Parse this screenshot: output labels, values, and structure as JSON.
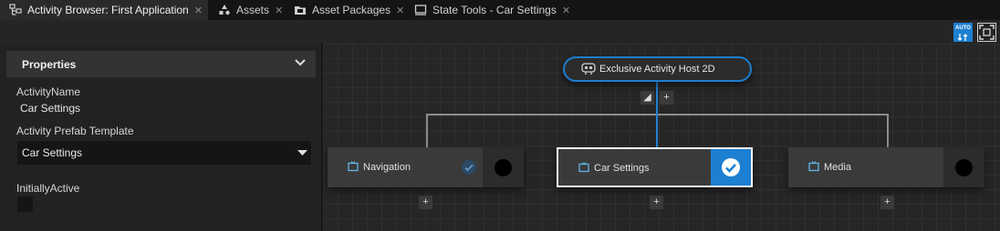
{
  "tabs": [
    {
      "label": "Activity Browser: First Application",
      "icon": "activity-tree-icon",
      "active": true
    },
    {
      "label": "Assets",
      "icon": "assets-icon",
      "active": false
    },
    {
      "label": "Asset Packages",
      "icon": "asset-packages-icon",
      "active": false
    },
    {
      "label": "State Tools - Car Settings",
      "icon": "state-tools-icon",
      "active": false
    }
  ],
  "toolbar": {
    "auto_label": "AUTO"
  },
  "properties": {
    "header": "Properties",
    "activity_name_label": "ActivityName",
    "activity_name_value": "Car Settings",
    "prefab_label": "Activity Prefab Template",
    "prefab_value": "Car Settings",
    "initially_active_label": "InitiallyActive",
    "initially_active_checked": false
  },
  "graph": {
    "host_label": "Exclusive Activity Host 2D",
    "nodes": [
      {
        "label": "Navigation",
        "selected": false,
        "status": "default-checked"
      },
      {
        "label": "Car Settings",
        "selected": true,
        "status": "active-checked"
      },
      {
        "label": "Media",
        "selected": false,
        "status": "unchecked"
      }
    ]
  },
  "colors": {
    "accent": "#1d7fd1",
    "background": "#252525"
  }
}
